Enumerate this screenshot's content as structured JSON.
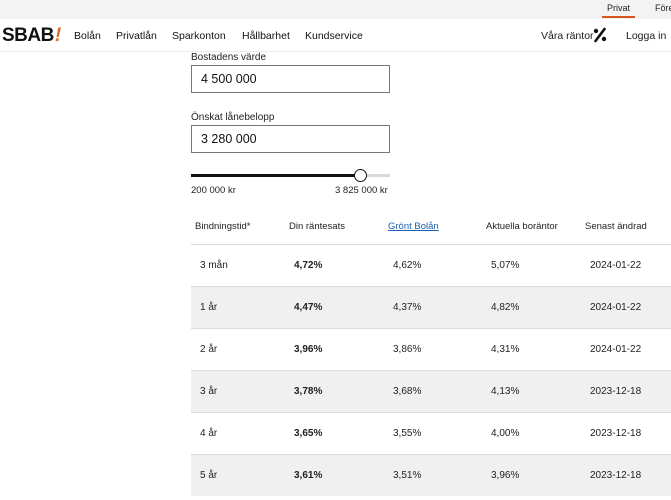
{
  "topbar": {
    "privat": "Privat",
    "foretag": "Företag"
  },
  "nav": {
    "logo": "SBAB",
    "logo_mark": "!",
    "links": [
      "Bolån",
      "Privatlån",
      "Sparkonton",
      "Hållbarhet",
      "Kundservice"
    ],
    "rates_label": "Våra räntor",
    "login_label": "Logga in"
  },
  "form": {
    "property_label": "Bostadens värde",
    "property_value": "4 500 000",
    "loan_label": "Önskat lånebelopp",
    "loan_value": "3 280 000",
    "slider_min": "200 000 kr",
    "slider_max": "3 825 000 kr",
    "slider_level": 0.85
  },
  "table": {
    "headers": [
      "Bindningstid*",
      "Din räntesats",
      "Grönt Bolån",
      "Aktuella boräntor",
      "Senast ändrad"
    ],
    "rows": [
      [
        "3 mån",
        "4,72%",
        "4,62%",
        "5,07%",
        "2024-01-22"
      ],
      [
        "1 år",
        "4,47%",
        "4,37%",
        "4,82%",
        "2024-01-22"
      ],
      [
        "2 år",
        "3,96%",
        "3,86%",
        "4,31%",
        "2024-01-22"
      ],
      [
        "3 år",
        "3,78%",
        "3,68%",
        "4,13%",
        "2023-12-18"
      ],
      [
        "4 år",
        "3,65%",
        "3,55%",
        "4,00%",
        "2023-12-18"
      ],
      [
        "5 år",
        "3,61%",
        "3,51%",
        "3,96%",
        "2023-12-18"
      ]
    ]
  },
  "colors": {
    "accent": "#e0691f",
    "link": "#1d5fb0",
    "row_alt": "#f0f0f0"
  }
}
